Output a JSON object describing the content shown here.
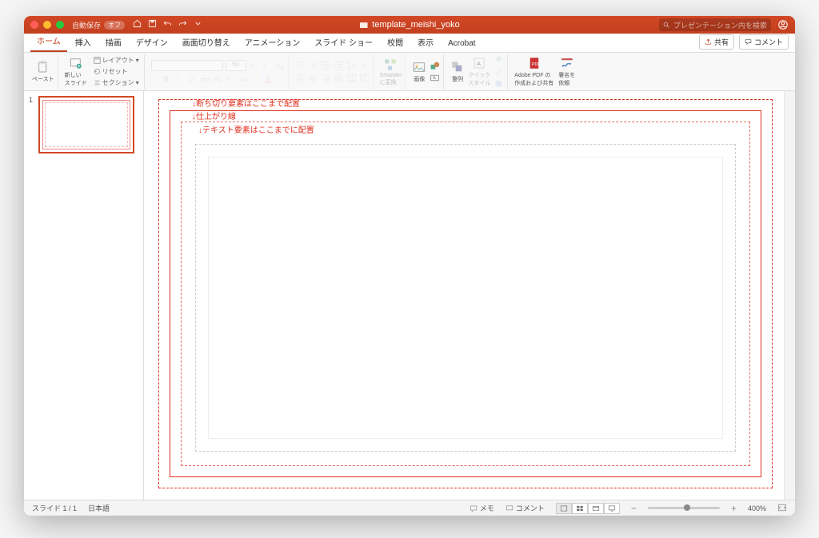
{
  "titlebar": {
    "autosave_label": "自動保存",
    "autosave_state": "オフ",
    "doc_title": "template_meishi_yoko",
    "search_placeholder": "プレゼンテーション内を検索"
  },
  "tabs": {
    "items": [
      "ホーム",
      "挿入",
      "描画",
      "デザイン",
      "画面切り替え",
      "アニメーション",
      "スライド ショー",
      "校閲",
      "表示",
      "Acrobat"
    ],
    "active_index": 0,
    "share": "共有",
    "comment": "コメント"
  },
  "ribbon": {
    "paste": "ペースト",
    "new_slide": "新しい\nスライド",
    "layout": "レイアウト",
    "reset": "リセット",
    "section": "セクション",
    "font_size_placeholder": "60",
    "smartart": "SmartArt\nに変換",
    "picture": "画像",
    "arrange": "整列",
    "quickstyle": "クイック\nスタイル",
    "adobe_pdf": "Adobe PDF の\n作成および共有",
    "signature": "署名を\n依頼"
  },
  "thumbs": {
    "slide_number": "1"
  },
  "slide": {
    "annot_bleed": "↓断ち切り要素はここまで配置",
    "annot_trim": "↓仕上がり線",
    "annot_safe": "↓テキスト要素はここまでに配置"
  },
  "status": {
    "slide_count": "スライド 1 / 1",
    "language": "日本語",
    "notes": "メモ",
    "comments": "コメント",
    "zoom": "400%"
  }
}
